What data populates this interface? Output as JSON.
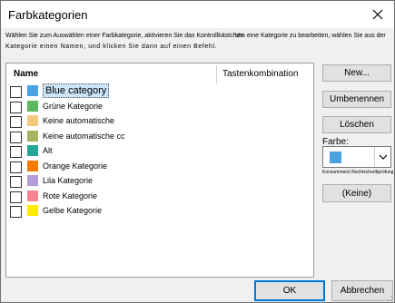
{
  "window": {
    "title": "Farbkategorien",
    "close_icon": "close-icon"
  },
  "instructions": {
    "line1_left": "Wählen Sie zum Auswählen einer Farbkategorie, aktivieren Sie das Kontrollkästchen.",
    "line1_right": "Um eine Kategorie zu bearbeiten, wählen Sie aus der",
    "line2": "Kategorie einen Namen, und klicken Sie dann auf einen Befehl."
  },
  "list": {
    "header_name": "Name",
    "header_shortcut": "Tastenkombination",
    "items": [
      {
        "label": "Blue category",
        "color": "#4aa3df",
        "checked": false,
        "selected": true
      },
      {
        "label": "Grüne Kategorie",
        "color": "#5cb85c",
        "checked": false,
        "selected": false
      },
      {
        "label": "Keine automatische",
        "color": "#f5c77e",
        "checked": false,
        "selected": false
      },
      {
        "label": "Keine automatische cc",
        "color": "#a4b55f",
        "checked": false,
        "selected": false
      },
      {
        "label": "Alt",
        "color": "#26a69a",
        "checked": false,
        "selected": false
      },
      {
        "label": "Orange Kategorie",
        "color": "#f57c00",
        "checked": false,
        "selected": false
      },
      {
        "label": "Lila Kategorie",
        "color": "#b39ddb",
        "checked": false,
        "selected": false
      },
      {
        "label": "Rote Kategorie",
        "color": "#f48590",
        "checked": false,
        "selected": false
      },
      {
        "label": "Gelbe Kategorie",
        "color": "#ffeb00",
        "checked": false,
        "selected": false
      }
    ]
  },
  "side": {
    "new_label": "New...",
    "rename_label": "Umbenennen",
    "delete_label": "Löschen",
    "color_label": "Farbe:",
    "color_value": "#4aa3df",
    "hint": "Konsummenü Rechtschreibprüfung",
    "none_label": "(Keine)"
  },
  "footer": {
    "ok_label": "OK",
    "cancel_label": "Abbrechen"
  }
}
